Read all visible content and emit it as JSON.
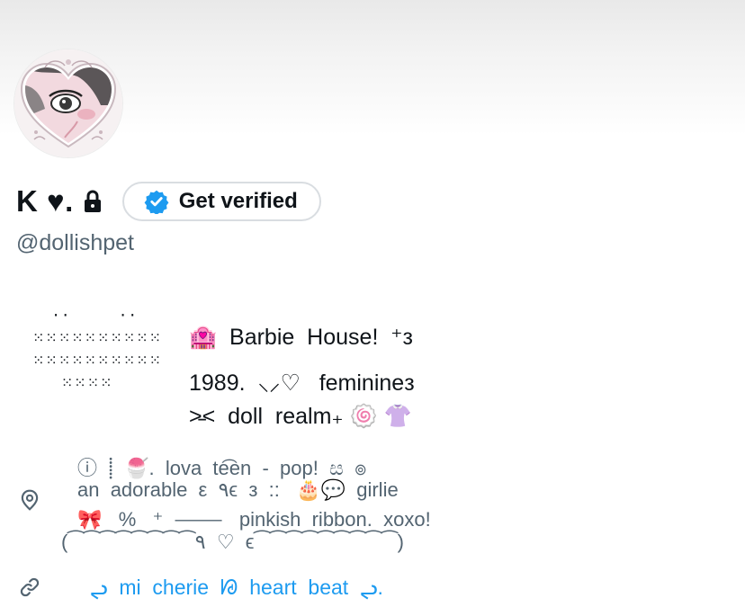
{
  "profile": {
    "display_name": "K ♥.",
    "handle": "@dollishpet",
    "verify_button_label": "Get verified",
    "icons": {
      "lock": "lock-icon",
      "verified_badge": "verified-badge-icon",
      "location": "location-pin-icon",
      "link": "link-icon"
    },
    "accent_color": "#1d9bf0"
  },
  "bio": {
    "heart_art": "  ··     ··\n⁙⁙⁙⁙⁙⁙⁙⁙⁙⁙\n⁙⁙⁙⁙⁙⁙⁙⁙⁙⁙\n   ⁙⁙⁙⁙",
    "line1": "🏩  Barbie  House!  ⁺з",
    "line2": "1989.  ⸜⸝♡   feminineз",
    "line3": "˃̵˂  doll  realm₊ 🍥 👚"
  },
  "location": {
    "line1": "ⓘ  ⸽  🍧.  lova  te͡en  -  pop!  ස  ๏",
    "line2": "an  adorable  ε  ٩ϵ  з  ::   🎂💬  girlie",
    "line3": "🎀   %   ⁺  ⸻   pinkish  ribbon.  xoxo!",
    "line4": "(⁀⁀⁀⁀⁀⁀⁀⁀٩  ♡  ϵ⁀⁀⁀⁀⁀⁀⁀⁀⁀)"
  },
  "website": {
    "text": "ᖢ  mi  cherie  ᘘ  heart  beat  ᖢ."
  }
}
